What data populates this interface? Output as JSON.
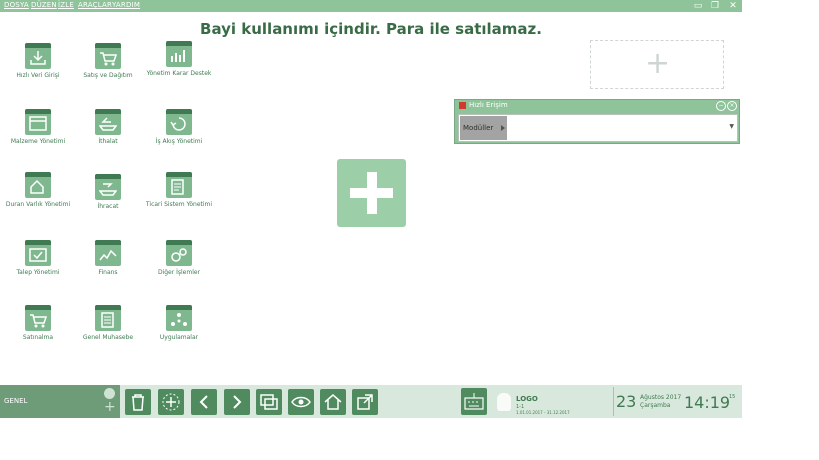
{
  "menu": [
    "DOSYA",
    "DÜZEN",
    "İZLE",
    "ARAÇLAR",
    "YARDIM"
  ],
  "banner": "Bayi kullanımı içindir. Para ile satılamaz.",
  "modules": [
    {
      "label": "Hızlı Veri Girişi",
      "icon": "download-tray-icon"
    },
    {
      "label": "Satış ve Dağıtım",
      "icon": "cart-icon"
    },
    {
      "label": "Yönetim Karar Destek",
      "icon": "report-chart-icon"
    },
    {
      "label": "Malzeme Yönetimi",
      "icon": "box-icon"
    },
    {
      "label": "İthalat",
      "icon": "ship-import-icon"
    },
    {
      "label": "İş Akış Yönetimi",
      "icon": "workflow-icon"
    },
    {
      "label": "Duran Varlık Yönetimi",
      "icon": "asset-house-icon"
    },
    {
      "label": "İhracat",
      "icon": "ship-export-icon"
    },
    {
      "label": "Ticari Sistem Yönetimi",
      "icon": "document-gear-icon"
    },
    {
      "label": "Talep Yönetimi",
      "icon": "request-check-icon"
    },
    {
      "label": "Finans",
      "icon": "finance-chart-icon"
    },
    {
      "label": "Diğer İşlemler",
      "icon": "gears-icon"
    },
    {
      "label": "Satınalma",
      "icon": "shopping-cart-icon"
    },
    {
      "label": "Genel Muhasebe",
      "icon": "ledger-icon"
    },
    {
      "label": "Uygulamalar",
      "icon": "apps-dots-icon"
    }
  ],
  "quick_access": {
    "title": "Hızlı Erişim",
    "select_label": "Modüller"
  },
  "bottom": {
    "genel": "GENEL",
    "toolbar_icons": [
      "trash-icon",
      "add-dashed-icon",
      "back-arrow-icon",
      "forward-arrow-icon",
      "windows-star-icon",
      "eye-view-icon",
      "home-icon",
      "export-icon"
    ],
    "logo_title": "LOGO",
    "logo_sub1": "1-1",
    "logo_sub2": "1.01.01.2017 - 31.12.2017",
    "day": "23",
    "month_year": "Ağustos 2017",
    "weekday": "Çarşamba",
    "time": "14:19",
    "seconds": "15"
  },
  "colors": {
    "accent": "#8fc49a",
    "dark": "#3f7a52",
    "tile": "#7fb88f"
  }
}
